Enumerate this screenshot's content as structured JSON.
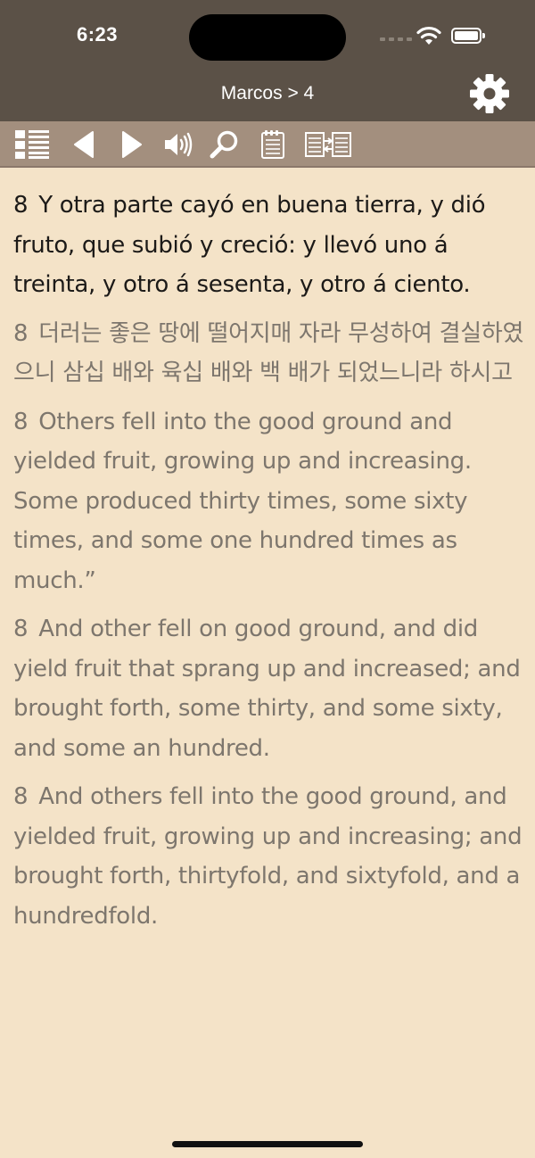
{
  "status_bar": {
    "time": "6:23"
  },
  "nav": {
    "title": "Marcos > 4"
  },
  "toolbar": {
    "icons": [
      "list-icon",
      "previous-icon",
      "next-icon",
      "speaker-icon",
      "search-icon",
      "notes-icon",
      "compare-icon"
    ]
  },
  "verses": [
    {
      "number": "8",
      "text": "Y otra parte cayó en buena tierra, y dió fruto, que subió y creció: y llevó uno á treinta, y otro á sesenta, y otro á ciento."
    },
    {
      "number": "8",
      "text": "더러는 좋은 땅에 떨어지매 자라 무성하여 결실하였으니 삼십 배와 육십 배와 백 배가 되었느니라 하시고"
    },
    {
      "number": "8",
      "text": "Others fell into the good ground and yielded fruit, growing up and increasing. Some produced thirty times, some sixty times, and some one hundred times as much.”"
    },
    {
      "number": "8",
      "text": "And other fell on good ground, and did yield fruit that sprang up and increased; and brought forth, some thirty, and some sixty, and some an hundred."
    },
    {
      "number": "8",
      "text": "And others fell into the good ground, and yielded fruit, growing up and increasing; and brought forth, thirtyfold, and sixtyfold, and a hundredfold."
    }
  ],
  "colors": {
    "header": "#5b5147",
    "toolbar": "#a38f7e",
    "background": "#f4e3c8",
    "primary_text": "#1c1a18",
    "secondary_text": "#7d766d"
  }
}
